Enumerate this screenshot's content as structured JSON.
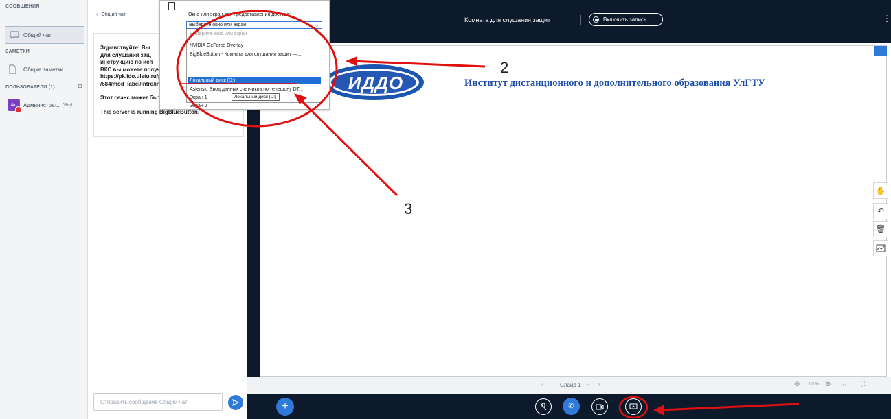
{
  "sidebar": {
    "messages_header": "СООБЩЕНИЯ",
    "public_chat": "Общий чат",
    "notes_header": "ЗАМЕТКИ",
    "shared_notes": "Общие заметки",
    "users_header": "ПОЛЬЗОВАТЕЛИ (1)",
    "user_name": "Администрат...",
    "user_you": "(Вы)",
    "user_avatar": "Ад"
  },
  "chat": {
    "back_label": "Общий чат",
    "welcome_lines": [
      "Здравствуйте! Вы",
      "для слушания защ",
      "инструкцию по исп",
      "ВКС вы можете получить",
      "https://pk.ido.ulstu.ru/pluginfi",
      "/684/mod_label/intro/info_",
      "Этот сеанс может быть зап",
      "This server is running "
    ],
    "server_link": "BigBlueButton",
    "server_end": ".",
    "input_placeholder": "Отправить сообщение Общий чат"
  },
  "topbar": {
    "room_title": "Комната для слушания защит",
    "record_label": "Включить запись",
    "menu_icon": "⋮"
  },
  "dialog": {
    "prompt": "Окно или экран для предоставления доступа:",
    "select_value": "Выберите окно или экран",
    "options": [
      "Выберите окно или экран",
      "NVIDIA GeForce Overlay",
      "BigBlueButton - Комната для слушания защит —...",
      "",
      "Локальный диск (D:)",
      "Asterisk: Ввод данных счетчиков по телефону DT...",
      "Экран 1",
      "Экран 2"
    ],
    "tooltip": "Локальный диск (D:)"
  },
  "slide": {
    "logo_text": "ИДДО",
    "institute_title": "Институт дистанционного и дополнительного образования УлГТУ"
  },
  "presbar": {
    "slide_label": "Слайд 1",
    "zoom": "100%"
  },
  "annotations": {
    "label_2": "2",
    "label_3": "3"
  },
  "colors": {
    "dark_bg": "#0d1a2b",
    "accent_blue": "#2f7ad8",
    "annotation_red": "#e01010",
    "selected_option": "#1f6fd6"
  }
}
